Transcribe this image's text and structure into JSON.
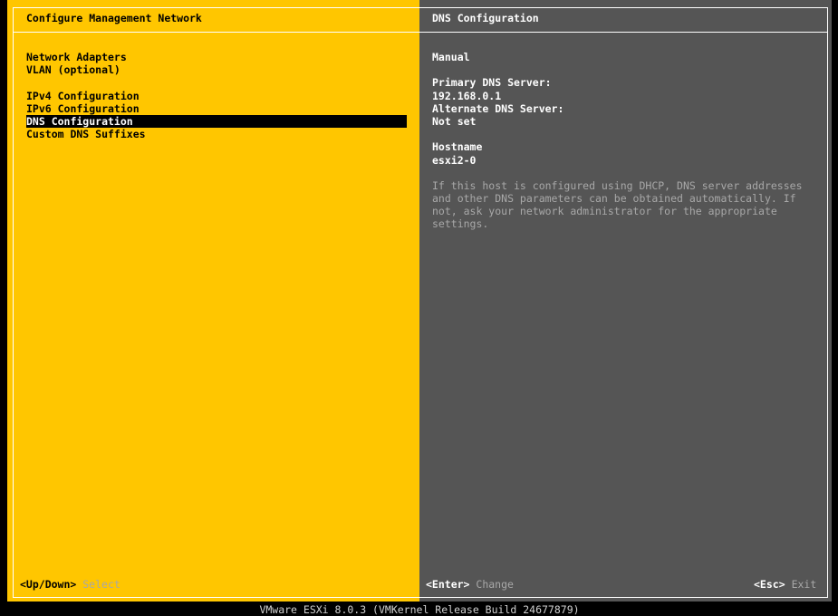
{
  "left_panel": {
    "title": "Configure Management Network",
    "menu": [
      {
        "label": "Network Adapters",
        "selected": false
      },
      {
        "label": "VLAN (optional)",
        "selected": false
      },
      {
        "label": "IPv4 Configuration",
        "selected": false
      },
      {
        "label": "IPv6 Configuration",
        "selected": false
      },
      {
        "label": "DNS Configuration",
        "selected": true
      },
      {
        "label": "Custom DNS Suffixes",
        "selected": false
      }
    ]
  },
  "right_panel": {
    "title": "DNS Configuration",
    "mode": "Manual",
    "primary_dns_label": "Primary DNS Server:",
    "primary_dns_value": "192.168.0.1",
    "alternate_dns_label": "Alternate DNS Server:",
    "alternate_dns_value": "Not set",
    "hostname_label": "Hostname",
    "hostname_value": "esxi2-0",
    "help_text": "If this host is configured using DHCP, DNS server addresses\nand other DNS parameters can be obtained automatically. If\nnot, ask your network administrator for the appropriate\nsettings."
  },
  "footer": {
    "updown_key": "<Up/Down>",
    "updown_action": "Select",
    "enter_key": "<Enter>",
    "enter_action": "Change",
    "esc_key": "<Esc>",
    "esc_action": "Exit"
  },
  "status_bar": "VMware ESXi 8.0.3 (VMKernel Release Build 24677879)",
  "colors": {
    "left_background": "#ffc600",
    "right_background": "#555555",
    "selection_background": "#000000",
    "dim_text": "#a8a8a8"
  }
}
